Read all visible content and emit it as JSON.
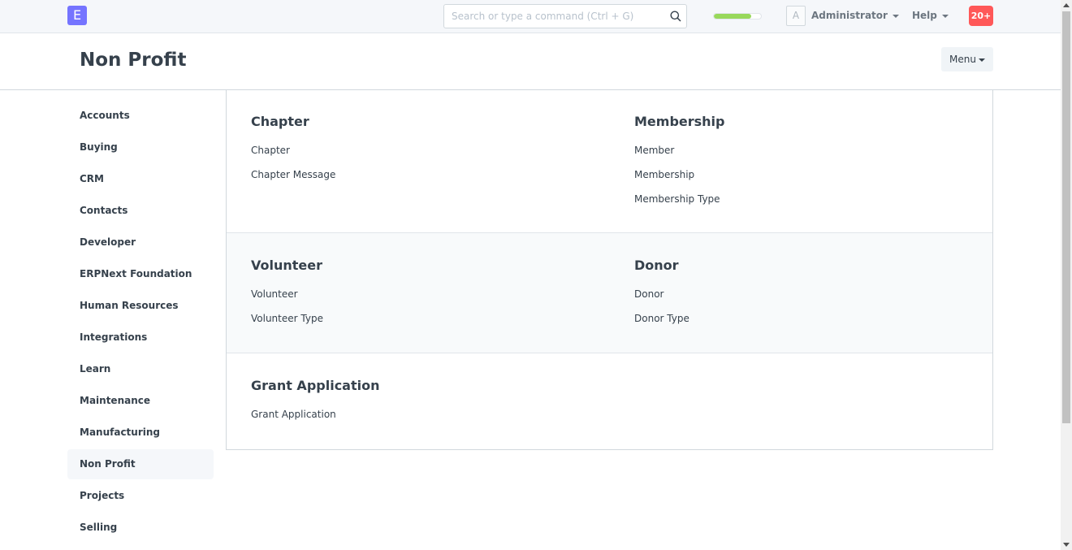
{
  "navbar": {
    "logo_letter": "E",
    "search_placeholder": "Search or type a command (Ctrl + G)",
    "progress_fraction": 0.8,
    "avatar_letter": "A",
    "user_label": "Administrator",
    "help_label": "Help",
    "notification_count": "20+",
    "colors": {
      "logo": "#7574ff",
      "progress": "#98d85b",
      "notification": "#ff5858"
    }
  },
  "page": {
    "title": "Non Profit",
    "menu_label": "Menu"
  },
  "sidebar": {
    "items": [
      {
        "label": "Accounts"
      },
      {
        "label": "Buying"
      },
      {
        "label": "CRM"
      },
      {
        "label": "Contacts"
      },
      {
        "label": "Developer"
      },
      {
        "label": "ERPNext Foundation"
      },
      {
        "label": "Human Resources"
      },
      {
        "label": "Integrations"
      },
      {
        "label": "Learn"
      },
      {
        "label": "Maintenance"
      },
      {
        "label": "Manufacturing"
      },
      {
        "label": "Non Profit"
      },
      {
        "label": "Projects"
      },
      {
        "label": "Selling"
      }
    ],
    "active_index": 11
  },
  "sections": [
    {
      "columns": [
        {
          "title": "Chapter",
          "links": [
            "Chapter",
            "Chapter Message"
          ]
        },
        {
          "title": "Membership",
          "links": [
            "Member",
            "Membership",
            "Membership Type"
          ]
        }
      ]
    },
    {
      "columns": [
        {
          "title": "Volunteer",
          "links": [
            "Volunteer",
            "Volunteer Type"
          ]
        },
        {
          "title": "Donor",
          "links": [
            "Donor",
            "Donor Type"
          ]
        }
      ]
    },
    {
      "columns": [
        {
          "title": "Grant Application",
          "links": [
            "Grant Application"
          ]
        }
      ]
    }
  ]
}
